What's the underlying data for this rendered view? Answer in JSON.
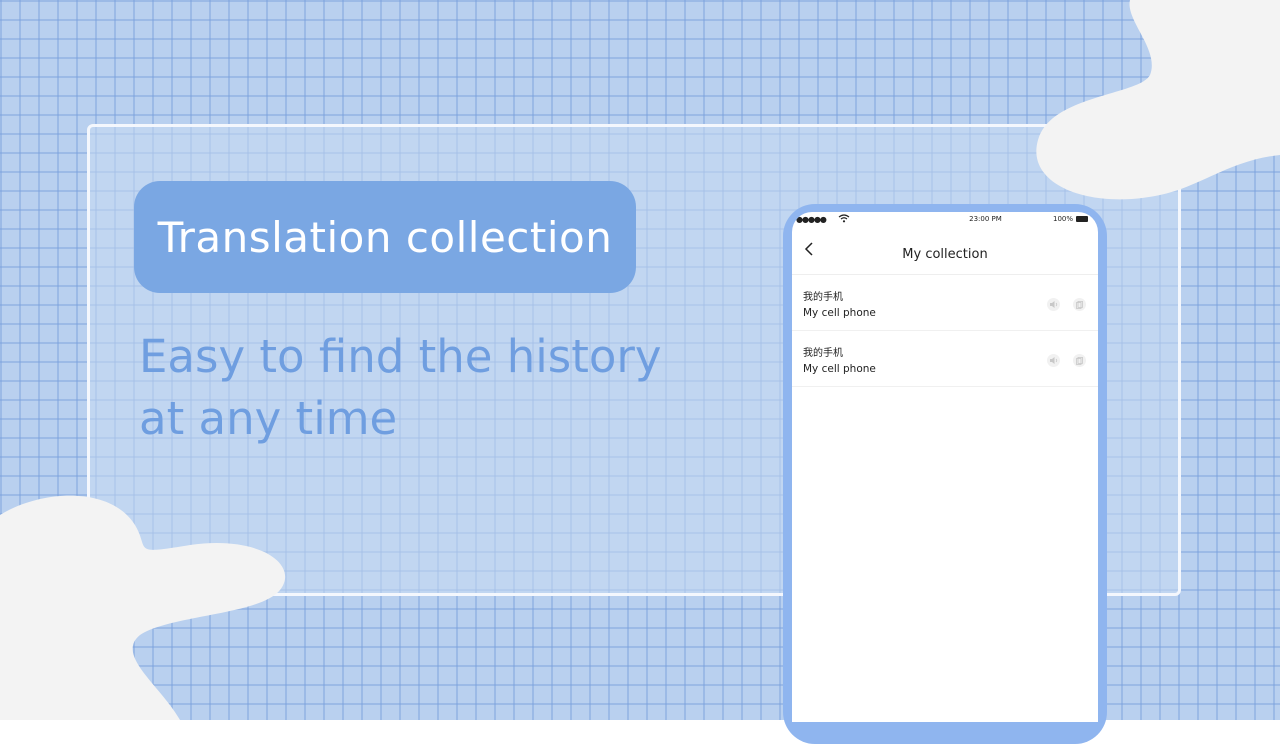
{
  "headline": "Translation collection",
  "subtitle": "Easy to find the history at any time",
  "phone": {
    "status": {
      "signal": "●●●●●",
      "time": "23:00 PM",
      "battery": "100%"
    },
    "nav_title": "My collection",
    "items": [
      {
        "source": "我的手机",
        "translation": "My cell  phone"
      },
      {
        "source": "我的手机",
        "translation": "My cell  phone"
      }
    ]
  },
  "colors": {
    "accent": "#7aa7e3",
    "subtitle": "#6f9ee0",
    "background": "#b9d0ef",
    "phone_frame": "#8fb5ef"
  }
}
